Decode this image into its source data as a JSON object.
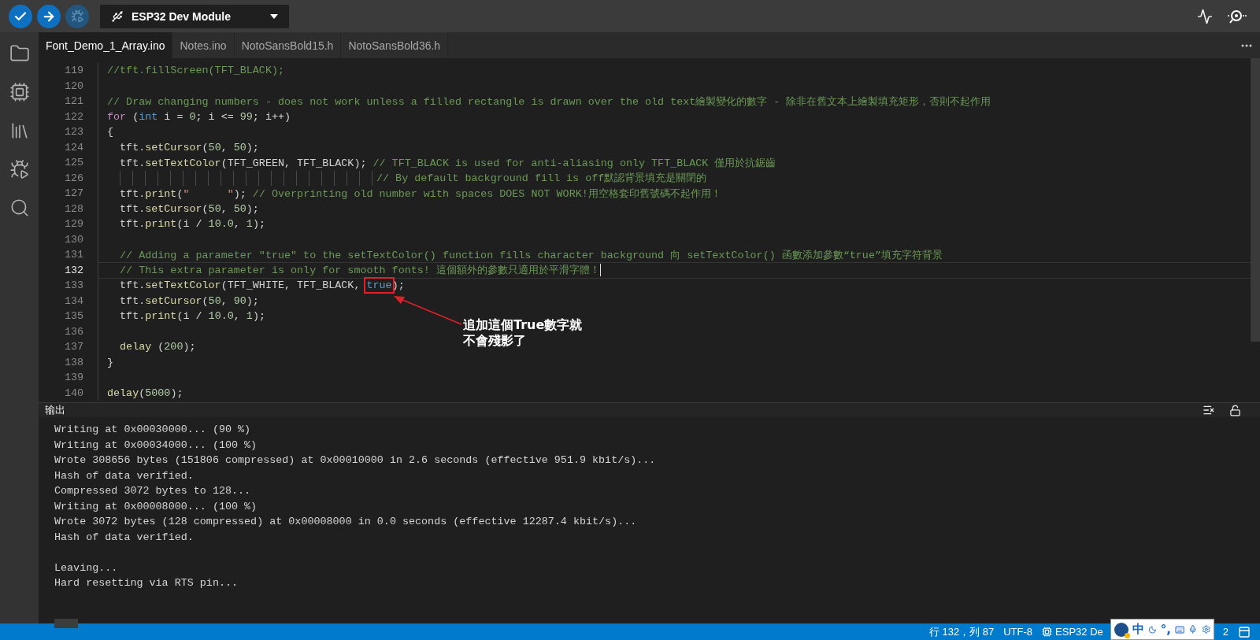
{
  "toolbar": {
    "board": "ESP32 Dev Module",
    "debug_enabled": false
  },
  "tabs": [
    {
      "label": "Font_Demo_1_Array.ino",
      "selected": true
    },
    {
      "label": "Notes.ino",
      "selected": false
    },
    {
      "label": "NotoSansBold15.h",
      "selected": false
    },
    {
      "label": "NotoSansBold36.h",
      "selected": false
    }
  ],
  "editor": {
    "lines": [
      {
        "number": "119",
        "kind": "code",
        "active": false,
        "tokens": [
          {
            "kind": "comment",
            "text": "//tft.fillScreen(TFT_BLACK);"
          }
        ]
      },
      {
        "number": "120",
        "kind": "code",
        "active": false
      },
      {
        "number": "121",
        "kind": "code",
        "active": false,
        "tokens": [
          {
            "kind": "comment",
            "text": "// Draw changing numbers - does not work unless a filled rectangle is drawn over the old text繪製變化的數字 - 除非在舊文本上繪製填充矩形，否則不起作用"
          }
        ]
      },
      {
        "number": "122",
        "kind": "code",
        "active": false,
        "tokens": [
          {
            "kind": "keyword",
            "text": "for"
          },
          {
            "kind": "plain",
            "text": " ("
          },
          {
            "kind": "type",
            "text": "int"
          },
          {
            "kind": "plain",
            "text": " i = "
          },
          {
            "kind": "number",
            "text": "0"
          },
          {
            "kind": "plain",
            "text": "; i <= "
          },
          {
            "kind": "number",
            "text": "99"
          },
          {
            "kind": "plain",
            "text": "; i++)"
          }
        ]
      },
      {
        "number": "123",
        "kind": "code",
        "active": false,
        "tokens": [
          {
            "kind": "plain",
            "text": "{"
          }
        ]
      },
      {
        "number": "124",
        "kind": "code",
        "active": false,
        "tokens": [
          {
            "kind": "plain",
            "text": "  tft."
          },
          {
            "kind": "func",
            "text": "setCursor"
          },
          {
            "kind": "plain",
            "text": "("
          },
          {
            "kind": "number",
            "text": "50"
          },
          {
            "kind": "plain",
            "text": ", "
          },
          {
            "kind": "number",
            "text": "50"
          },
          {
            "kind": "plain",
            "text": ");"
          }
        ]
      },
      {
        "number": "125",
        "kind": "code",
        "active": false,
        "tokens": [
          {
            "kind": "plain",
            "text": "  tft."
          },
          {
            "kind": "func",
            "text": "setTextColor"
          },
          {
            "kind": "plain",
            "text": "(TFT_GREEN, TFT_BLACK); "
          },
          {
            "kind": "comment",
            "text": "// TFT_BLACK is used for anti-aliasing only TFT_BLACK 僅用於抗鋸齒"
          }
        ]
      },
      {
        "number": "126",
        "kind": "continuation",
        "active": false,
        "tokens": [
          {
            "kind": "comment",
            "text": "// By default background fill is off默認背景填充是關閉的"
          }
        ]
      },
      {
        "number": "127",
        "kind": "code",
        "active": false,
        "tokens": [
          {
            "kind": "plain",
            "text": "  tft."
          },
          {
            "kind": "func",
            "text": "print"
          },
          {
            "kind": "plain",
            "text": "("
          },
          {
            "kind": "string",
            "text": "\"      \""
          },
          {
            "kind": "plain",
            "text": "); "
          },
          {
            "kind": "comment",
            "text": "// Overprinting old number with spaces DOES NOT WORK!用空格套印舊號碼不起作用！"
          }
        ]
      },
      {
        "number": "128",
        "kind": "code",
        "active": false,
        "tokens": [
          {
            "kind": "plain",
            "text": "  tft."
          },
          {
            "kind": "func",
            "text": "setCursor"
          },
          {
            "kind": "plain",
            "text": "("
          },
          {
            "kind": "number",
            "text": "50"
          },
          {
            "kind": "plain",
            "text": ", "
          },
          {
            "kind": "number",
            "text": "50"
          },
          {
            "kind": "plain",
            "text": ");"
          }
        ]
      },
      {
        "number": "129",
        "kind": "code",
        "active": false,
        "tokens": [
          {
            "kind": "plain",
            "text": "  tft."
          },
          {
            "kind": "func",
            "text": "print"
          },
          {
            "kind": "plain",
            "text": "(i / "
          },
          {
            "kind": "number",
            "text": "10.0"
          },
          {
            "kind": "plain",
            "text": ", "
          },
          {
            "kind": "number",
            "text": "1"
          },
          {
            "kind": "plain",
            "text": ");"
          }
        ]
      },
      {
        "number": "130",
        "kind": "code",
        "active": false
      },
      {
        "number": "131",
        "kind": "code",
        "active": false,
        "tokens": [
          {
            "kind": "comment",
            "text": "  // Adding a parameter \"true\" to the setTextColor() function fills character background 向 setTextColor() 函數添加參數“true”填充字符背景"
          }
        ]
      },
      {
        "number": "132",
        "kind": "code",
        "active": true,
        "tokens": [
          {
            "kind": "comment",
            "text": "  // This extra parameter is only for smooth fonts! 這個額外的參數只適用於平滑字體！"
          }
        ]
      },
      {
        "number": "133",
        "kind": "code",
        "active": false,
        "tokens": [
          {
            "kind": "plain",
            "text": "  tft."
          },
          {
            "kind": "func",
            "text": "setTextColor"
          },
          {
            "kind": "plain",
            "text": "(TFT_WHITE, TFT_BLACK, "
          },
          {
            "kind": "bool",
            "text": "true",
            "annotated": true
          },
          {
            "kind": "plain",
            "text": ");"
          }
        ]
      },
      {
        "number": "134",
        "kind": "code",
        "active": false,
        "tokens": [
          {
            "kind": "plain",
            "text": "  tft."
          },
          {
            "kind": "func",
            "text": "setCursor"
          },
          {
            "kind": "plain",
            "text": "("
          },
          {
            "kind": "number",
            "text": "50"
          },
          {
            "kind": "plain",
            "text": ", "
          },
          {
            "kind": "number",
            "text": "90"
          },
          {
            "kind": "plain",
            "text": ");"
          }
        ]
      },
      {
        "number": "135",
        "kind": "code",
        "active": false,
        "tokens": [
          {
            "kind": "plain",
            "text": "  tft."
          },
          {
            "kind": "func",
            "text": "print"
          },
          {
            "kind": "plain",
            "text": "(i / "
          },
          {
            "kind": "number",
            "text": "10.0"
          },
          {
            "kind": "plain",
            "text": ", "
          },
          {
            "kind": "number",
            "text": "1"
          },
          {
            "kind": "plain",
            "text": ");"
          }
        ]
      },
      {
        "number": "136",
        "kind": "code",
        "active": false
      },
      {
        "number": "137",
        "kind": "code",
        "active": false,
        "tokens": [
          {
            "kind": "func",
            "text": "  delay"
          },
          {
            "kind": "plain",
            "text": " ("
          },
          {
            "kind": "number",
            "text": "200"
          },
          {
            "kind": "plain",
            "text": ");"
          }
        ]
      },
      {
        "number": "138",
        "kind": "code",
        "active": false,
        "tokens": [
          {
            "kind": "plain",
            "text": "}"
          }
        ]
      },
      {
        "number": "139",
        "kind": "code",
        "active": false
      },
      {
        "number": "140",
        "kind": "code",
        "active": false,
        "tokens": [
          {
            "kind": "func",
            "text": "delay"
          },
          {
            "kind": "plain",
            "text": "("
          },
          {
            "kind": "number",
            "text": "5000"
          },
          {
            "kind": "plain",
            "text": ");"
          }
        ]
      }
    ],
    "callout": [
      "追加這個True數字就",
      "不會殘影了"
    ]
  },
  "output": {
    "title": "输出",
    "blocks": [
      [
        "Writing at 0x00030000... (90 %)",
        "Writing at 0x00034000... (100 %)",
        "Wrote 308656 bytes (151806 compressed) at 0x00010000 in 2.6 seconds (effective 951.9 kbit/s)...",
        "Hash of data verified.",
        "Compressed 3072 bytes to 128...",
        "Writing at 0x00008000... (100 %)",
        "Wrote 3072 bytes (128 compressed) at 0x00008000 in 0.0 seconds (effective 12287.4 kbit/s)...",
        "Hash of data verified."
      ],
      [
        "Leaving...",
        "Hard resetting via RTS pin..."
      ]
    ]
  },
  "status_bar": {
    "position": "行 132，列 87",
    "encoding": "UTF-8",
    "board": "ESP32 De",
    "notifications": "2"
  },
  "ime_toolbar": {
    "mode": "中",
    "punctuation": "°,"
  }
}
